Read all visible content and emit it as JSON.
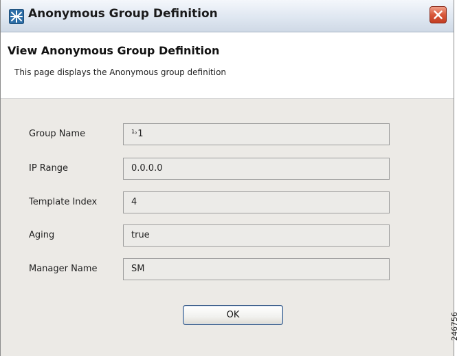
{
  "window": {
    "title": "Anonymous Group Definition",
    "icon": "app-icon"
  },
  "header": {
    "title": "View Anonymous Group Definition",
    "description": "This page displays the Anonymous group definition"
  },
  "form": {
    "fields": [
      {
        "label": "Group Name",
        "value": "¹˒1"
      },
      {
        "label": "IP Range",
        "value": "0.0.0.0"
      },
      {
        "label": "Template Index",
        "value": "4"
      },
      {
        "label": "Aging",
        "value": "true"
      },
      {
        "label": "Manager Name",
        "value": "SM"
      }
    ]
  },
  "buttons": {
    "ok_label": "OK"
  },
  "figure_id": "246756",
  "colors": {
    "close_button": "#d8573a",
    "ok_border": "#2a4f7e",
    "dialog_background": "#eceae6"
  }
}
